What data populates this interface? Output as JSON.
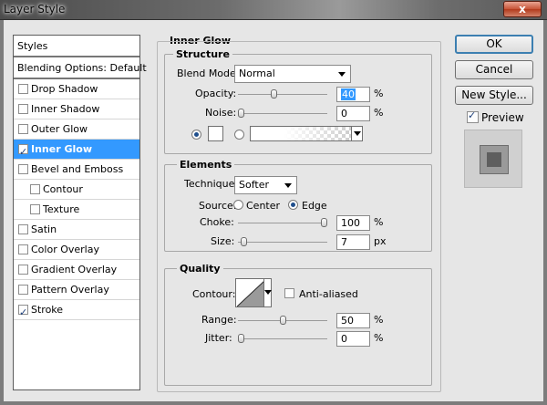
{
  "window": {
    "title": "Layer Style",
    "close_label": "x"
  },
  "styles_list": {
    "header": "Styles",
    "blending": "Blending Options: Default",
    "items": [
      {
        "label": "Drop Shadow",
        "checked": false
      },
      {
        "label": "Inner Shadow",
        "checked": false
      },
      {
        "label": "Outer Glow",
        "checked": false
      },
      {
        "label": "Inner Glow",
        "checked": true
      },
      {
        "label": "Bevel and Emboss",
        "checked": false
      },
      {
        "label": "Contour",
        "checked": false
      },
      {
        "label": "Texture",
        "checked": false
      },
      {
        "label": "Satin",
        "checked": false
      },
      {
        "label": "Color Overlay",
        "checked": false
      },
      {
        "label": "Gradient Overlay",
        "checked": false
      },
      {
        "label": "Pattern Overlay",
        "checked": false
      },
      {
        "label": "Stroke",
        "checked": true
      }
    ]
  },
  "inner_glow": {
    "title": "Inner Glow",
    "structure": {
      "title": "Structure",
      "blend_mode_label": "Blend Mode:",
      "blend_mode_value": "Normal",
      "opacity_label": "Opacity:",
      "opacity_value": "40",
      "opacity_unit": "%",
      "opacity_level": 0.4,
      "noise_label": "Noise:",
      "noise_value": "0",
      "noise_unit": "%",
      "noise_level": 0,
      "color_radio_selected": true,
      "gradient_radio_selected": false,
      "color": "#ffffff"
    },
    "elements": {
      "title": "Elements",
      "technique_label": "Technique:",
      "technique_value": "Softer",
      "source_label": "Source:",
      "source_center": "Center",
      "source_edge": "Edge",
      "source_selected": "Edge",
      "choke_label": "Choke:",
      "choke_value": "100",
      "choke_unit": "%",
      "choke_level": 1.0,
      "size_label": "Size:",
      "size_value": "7",
      "size_unit": "px",
      "size_level": 0.03
    },
    "quality": {
      "title": "Quality",
      "contour_label": "Contour:",
      "anti_aliased_label": "Anti-aliased",
      "anti_aliased_checked": false,
      "range_label": "Range:",
      "range_value": "50",
      "range_unit": "%",
      "range_level": 0.5,
      "jitter_label": "Jitter:",
      "jitter_value": "0",
      "jitter_unit": "%",
      "jitter_level": 0
    }
  },
  "buttons": {
    "ok": "OK",
    "cancel": "Cancel",
    "new_style": "New Style..."
  },
  "preview": {
    "label": "Preview",
    "checked": true
  },
  "colors": {
    "selection": "#3399ff",
    "default_button_border": "#3c7fb1"
  }
}
